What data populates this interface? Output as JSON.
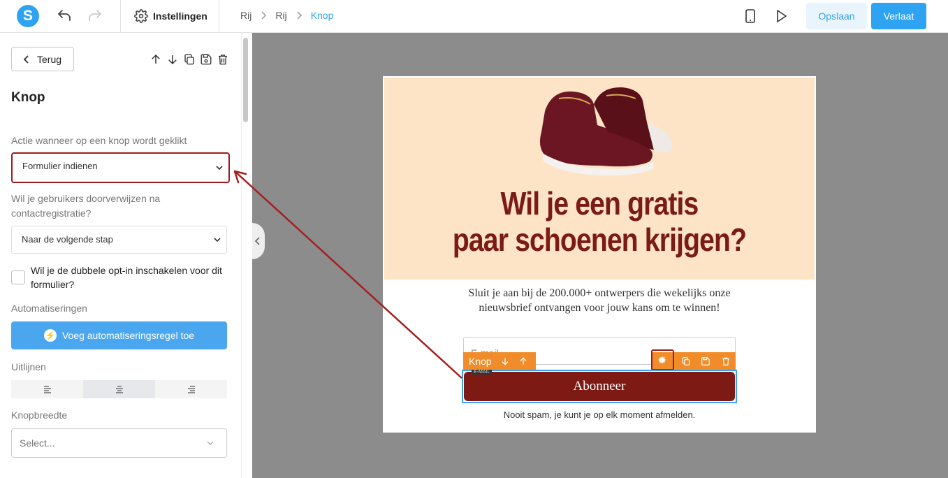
{
  "app": {
    "logo_letter": "S"
  },
  "toolbar": {
    "settings_label": "Instellingen",
    "breadcrumb": [
      "Rij",
      "Rij",
      "Knop"
    ],
    "save_label": "Opslaan",
    "leave_label": "Verlaat"
  },
  "sidebar": {
    "back_label": "Terug",
    "title": "Knop",
    "action_label": "Actie wanneer op een knop wordt geklikt",
    "action_value": "Formulier indienen",
    "redirect_label": "Wil je gebruikers doorverwijzen na contactregistratie?",
    "redirect_value": "Naar de volgende stap",
    "double_optin_label": "Wil je de dubbele opt-in inschakelen voor dit formulier?",
    "double_optin_checked": false,
    "automations_label": "Automatiseringen",
    "add_automation_label": "Voeg automatiseringsregel toe",
    "align_label": "Uitlijnen",
    "align_selected": "center",
    "width_label": "Knopbreedte",
    "width_placeholder": "Select..."
  },
  "canvas": {
    "headline_line1": "Wil je een gratis",
    "headline_line2": "paar schoenen krijgen?",
    "subtext": "Sluit je aan bij de 200.000+ ontwerpers die wekelijks onze nieuwsbrief ontvangen voor jouw kans om te winnen!",
    "email_placeholder": "E-mail",
    "element_toolbar_label": "Knop",
    "email_tag": "E-MAIL",
    "button_label": "Abonneer",
    "footer_note": "Nooit spam, je kunt je op elk moment afmelden."
  },
  "colors": {
    "accent": "#2ea3f2",
    "hero_bg": "#fde4c6",
    "headline": "#7a1b16",
    "button": "#7d1a14",
    "element_toolbar": "#f08d2a",
    "highlight": "#9b1c1c",
    "canvas_bg": "#8c8c8c"
  }
}
